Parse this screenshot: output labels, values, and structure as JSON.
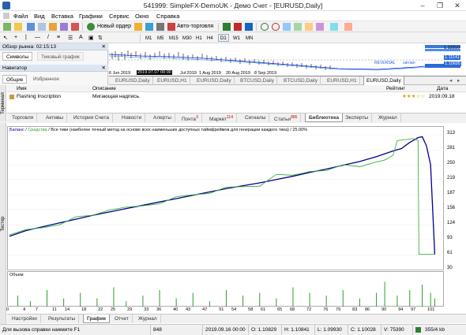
{
  "window": {
    "title": "541999: SimpleFX-DemoUK - Демо Счет - [EURUSD,Daily]",
    "buttons": [
      "–",
      "❐",
      "✕"
    ]
  },
  "menu": [
    "Файл",
    "Вид",
    "Вставка",
    "Графики",
    "Сервис",
    "Окно",
    "Справка"
  ],
  "toolbar": {
    "new_order": "Новый ордер",
    "autotrade": "Авто-торговля"
  },
  "timeframes": [
    "M1",
    "M5",
    "M15",
    "M30",
    "H1",
    "H4",
    "D1",
    "W1",
    "MN"
  ],
  "active_timeframe": "D1",
  "market_watch": {
    "title": "Обзор рынка: 02:15:13",
    "tabs": [
      "Символы",
      "Тиковый график"
    ]
  },
  "navigator": {
    "title": "Навигатор",
    "tabs": [
      "Общие",
      "Избранное"
    ]
  },
  "mini_chart": {
    "dates": [
      "6 Jun 2019",
      "2019.07.07 00:00",
      "Jul 2019",
      "1 Aug 2019",
      "20 Aug 2019",
      "8 Sep 2019"
    ],
    "prices": [
      "1.13310",
      "1.11141",
      "1.10695"
    ],
    "overlay": [
      "REVERSAL",
      "сигнал"
    ]
  },
  "chart_tabs": [
    "EURUSD,Daily",
    "EURUSD,H1",
    "EURUSD,Daily",
    "BTCUSD,Daily",
    "BTCUSD,Daily",
    "EURUSD,H1",
    "EURUSD,Daily"
  ],
  "active_chart_tab": 6,
  "terminal": {
    "label": "Терминал",
    "columns": [
      "Имя",
      "Описание",
      "Рейтинг",
      "Дата"
    ],
    "row": {
      "name": "Flashing Inscription",
      "desc": "Мигающая надпись.",
      "rating": "★★★☆☆",
      "date": "2019.09.18"
    },
    "tabs": [
      {
        "label": "Торговля"
      },
      {
        "label": "Активы"
      },
      {
        "label": "История Счета"
      },
      {
        "label": "Новости"
      },
      {
        "label": "Алерты"
      },
      {
        "label": "Почта",
        "badge": "3"
      },
      {
        "label": "Маркет",
        "badge": "114"
      },
      {
        "label": "Сигналы"
      },
      {
        "label": "Статьи",
        "badge": "886"
      },
      {
        "label": "Библиотека"
      },
      {
        "label": "Эксперты"
      },
      {
        "label": "Журнал"
      }
    ],
    "active_tab": 9
  },
  "tester": {
    "label": "Тестер",
    "legend": "Баланс / Средства / Все тики (наиболее точный метод на основе всех наименьших доступных таймфреймов для генерации каждого тика) / 25.00%",
    "legend_parts": {
      "balance": "Баланс",
      "equity": "Средства",
      "rest": "Все тики (наиболее точный метод на основе всех наименьших доступных таймфреймов для генерации каждого тика) / 25.00%"
    },
    "volume_label": "Объем",
    "tabs": [
      "Настройки",
      "Результаты",
      "График",
      "Отчет",
      "Журнал"
    ],
    "active_tab": 2
  },
  "chart_data": {
    "type": "line",
    "x_ticks": [
      0,
      4,
      7,
      11,
      14,
      18,
      22,
      25,
      29,
      33,
      36,
      40,
      43,
      47,
      51,
      54,
      58,
      61,
      65,
      68,
      72,
      76,
      79,
      83,
      86,
      90,
      94,
      97,
      101
    ],
    "y_ticks": [
      313,
      281,
      250,
      219,
      187,
      156,
      124,
      93,
      61,
      30
    ],
    "ylim": [
      30,
      313
    ],
    "xlim": [
      0,
      104
    ],
    "series": [
      {
        "name": "Баланс",
        "color": "#00008b",
        "x": [
          0,
          4,
          8,
          12,
          16,
          20,
          24,
          28,
          32,
          36,
          40,
          44,
          48,
          52,
          56,
          60,
          64,
          68,
          72,
          76,
          80,
          84,
          88,
          90,
          92,
          94,
          96,
          97,
          98,
          99,
          100,
          101,
          102
        ],
        "y": [
          100,
          112,
          120,
          128,
          136,
          144,
          151,
          158,
          165,
          172,
          179,
          186,
          193,
          200,
          206,
          212,
          219,
          226,
          234,
          241,
          249,
          257,
          267,
          273,
          279,
          284,
          297,
          302,
          307,
          309,
          290,
          250,
          62
        ]
      },
      {
        "name": "Средства",
        "color": "#3cb03c",
        "x": [
          0,
          4,
          8,
          12,
          16,
          20,
          24,
          28,
          32,
          36,
          40,
          44,
          48,
          52,
          56,
          60,
          64,
          68,
          72,
          76,
          80,
          84,
          88,
          90,
          92,
          93,
          95,
          97,
          98,
          98.2,
          99,
          100,
          101,
          102
        ],
        "y": [
          103,
          114,
          118,
          124,
          141,
          144,
          155,
          161,
          164,
          168,
          183,
          187,
          190,
          203,
          204,
          205,
          230,
          228,
          236,
          238,
          250,
          246,
          256,
          260,
          270,
          301,
          303,
          305,
          301,
          62,
          62,
          62,
          62,
          62
        ]
      }
    ],
    "volume": {
      "x": [
        2,
        5,
        9,
        13,
        17,
        21,
        25,
        28,
        32,
        36,
        40,
        44,
        48,
        52,
        56,
        60,
        64,
        68,
        72,
        76,
        80,
        84,
        88,
        90,
        93,
        96,
        99,
        101,
        102
      ],
      "y": [
        0.4,
        0.2,
        0.6,
        0.3,
        0.5,
        0.3,
        0.7,
        0.2,
        0.4,
        0.6,
        0.3,
        0.5,
        0.2,
        0.6,
        0.4,
        0.5,
        0.3,
        0.7,
        0.5,
        0.4,
        0.6,
        0.3,
        0.5,
        0.9,
        0.4,
        0.6,
        0.8,
        0.5,
        0.3
      ]
    }
  },
  "status": {
    "help": "Для вызова справки нажмите F1",
    "num": "848",
    "time": "2019.09.16 00:00",
    "o": "O: 1.10829",
    "h": "H: 1.10841",
    "l": "L: 1.09930",
    "c": "C: 1.10028",
    "v": "V: 75390",
    "traffic": "355/4 kb"
  }
}
